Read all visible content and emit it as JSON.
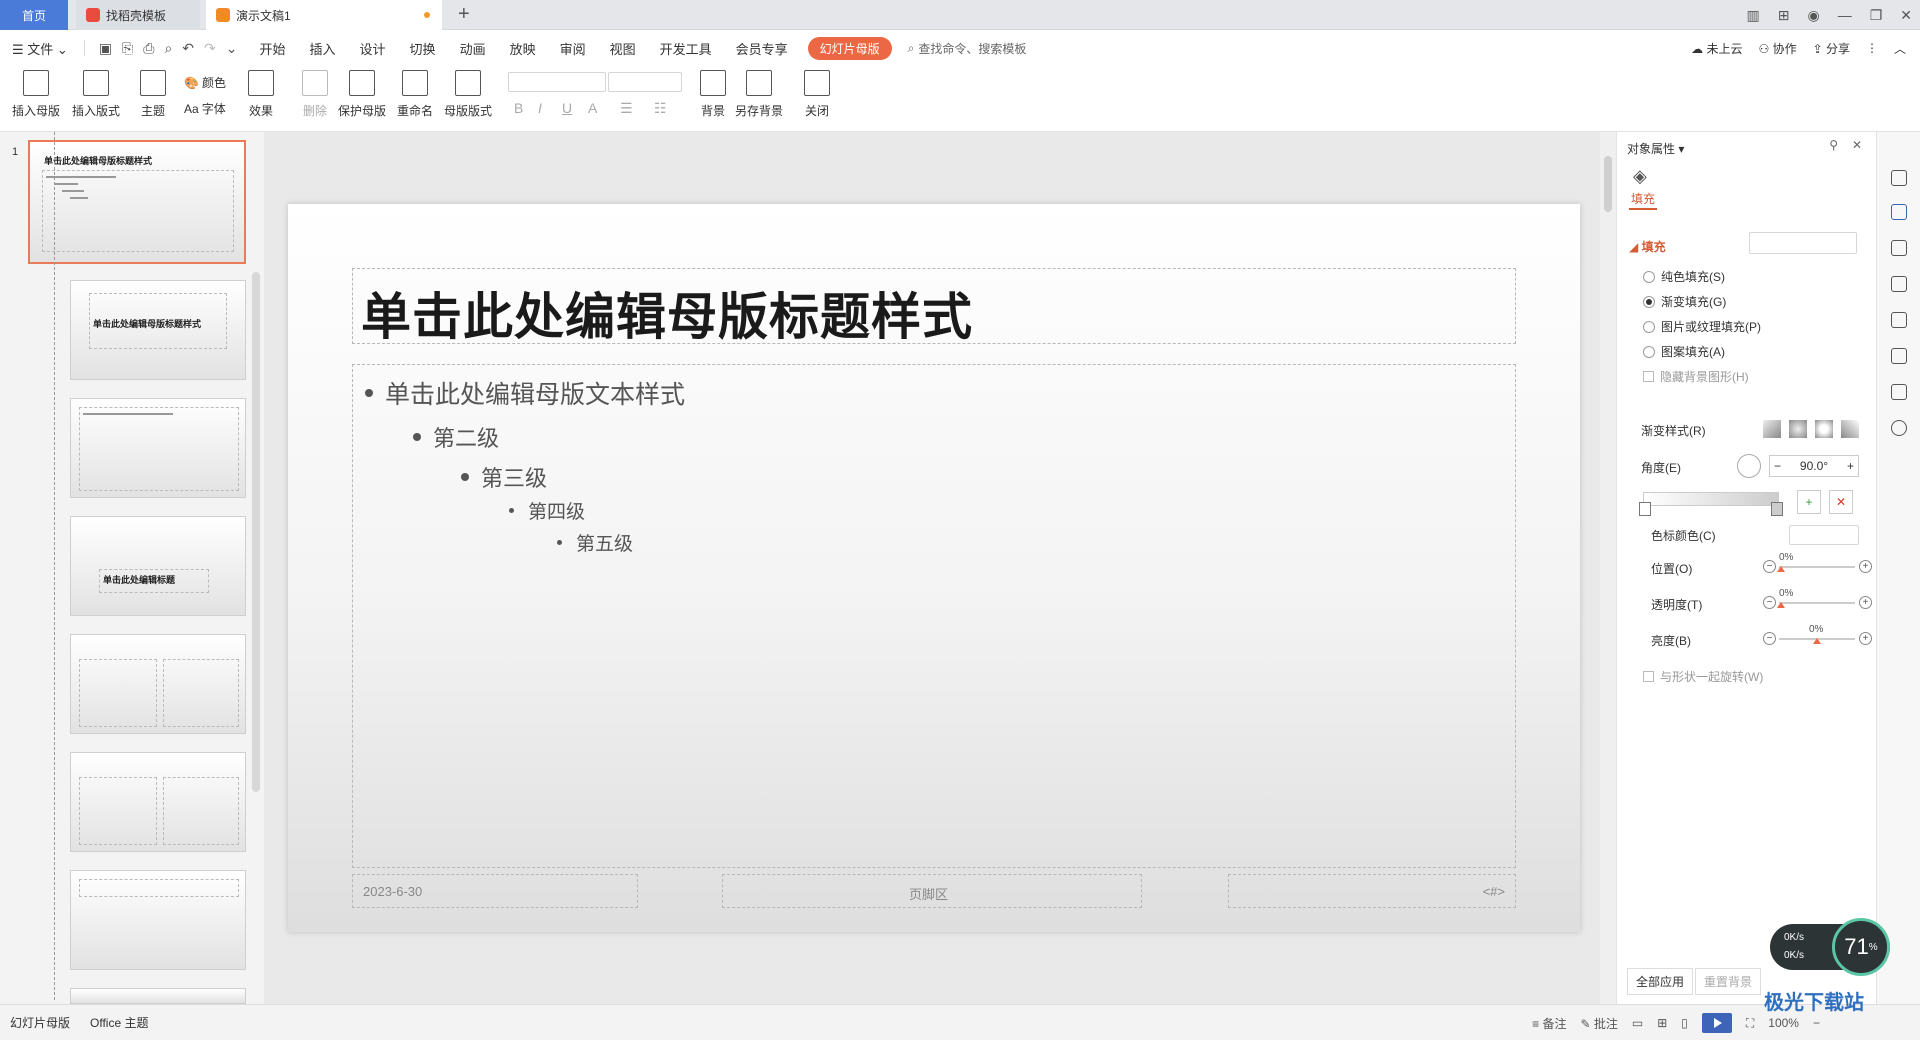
{
  "tabs": {
    "home": "首页",
    "template": "找稻壳模板",
    "doc": "演示文稿1"
  },
  "menu": {
    "file": "文件",
    "items": [
      "开始",
      "插入",
      "设计",
      "切换",
      "动画",
      "放映",
      "审阅",
      "视图",
      "开发工具",
      "会员专享"
    ],
    "active": "幻灯片母版",
    "search": "查找命令、搜索模板",
    "right": [
      "未上云",
      "协作",
      "分享"
    ]
  },
  "ribbon": {
    "insert_master": "插入母版",
    "insert_layout": "插入版式",
    "theme": "主题",
    "colors": "颜色",
    "fonts": "字体",
    "effects": "效果",
    "delete": "删除",
    "protect_master": "保护母版",
    "rename": "重命名",
    "master_layout": "母版版式",
    "background": "背景",
    "save_background": "另存背景",
    "close": "关闭"
  },
  "slides": {
    "master_number": "1",
    "master_title": "单击此处编辑母版标题样式",
    "layout2_title": "单击此处编辑母版标题样式",
    "layout4_title": "单击此处编辑标题"
  },
  "slide": {
    "title": "单击此处编辑母版标题样式",
    "levels": [
      "单击此处编辑母版文本样式",
      "第二级",
      "第三级",
      "第四级",
      "第五级"
    ],
    "footer_date": "2023-6-30",
    "footer_center": "页脚区",
    "footer_num": "<#>"
  },
  "props": {
    "header": "对象属性",
    "tab_fill": "填充",
    "section": "填充",
    "options": [
      "纯色填充(S)",
      "渐变填充(G)",
      "图片或纹理填充(P)",
      "图案填充(A)"
    ],
    "selected_option": "渐变填充(G)",
    "hide_bg": "隐藏背景图形(H)",
    "gradient_style": "渐变样式(R)",
    "angle_label": "角度(E)",
    "angle_value": "90.0°",
    "stop_color": "色标颜色(C)",
    "position_label": "位置(O)",
    "position_value": "0%",
    "transparency_label": "透明度(T)",
    "transparency_value": "0%",
    "brightness_label": "亮度(B)",
    "brightness_value": "0%",
    "rotate_with_shape": "与形状一起旋转(W)",
    "apply_all": "全部应用",
    "reset_bg": "重置背景"
  },
  "status": {
    "mode": "幻灯片母版",
    "theme": "Office 主题",
    "notes": "备注",
    "comments": "批注",
    "zoom": "100%"
  },
  "overlay": {
    "speed_up": "0K/s",
    "speed_down": "0K/s",
    "percent": "71",
    "watermark": "极光下载站"
  }
}
